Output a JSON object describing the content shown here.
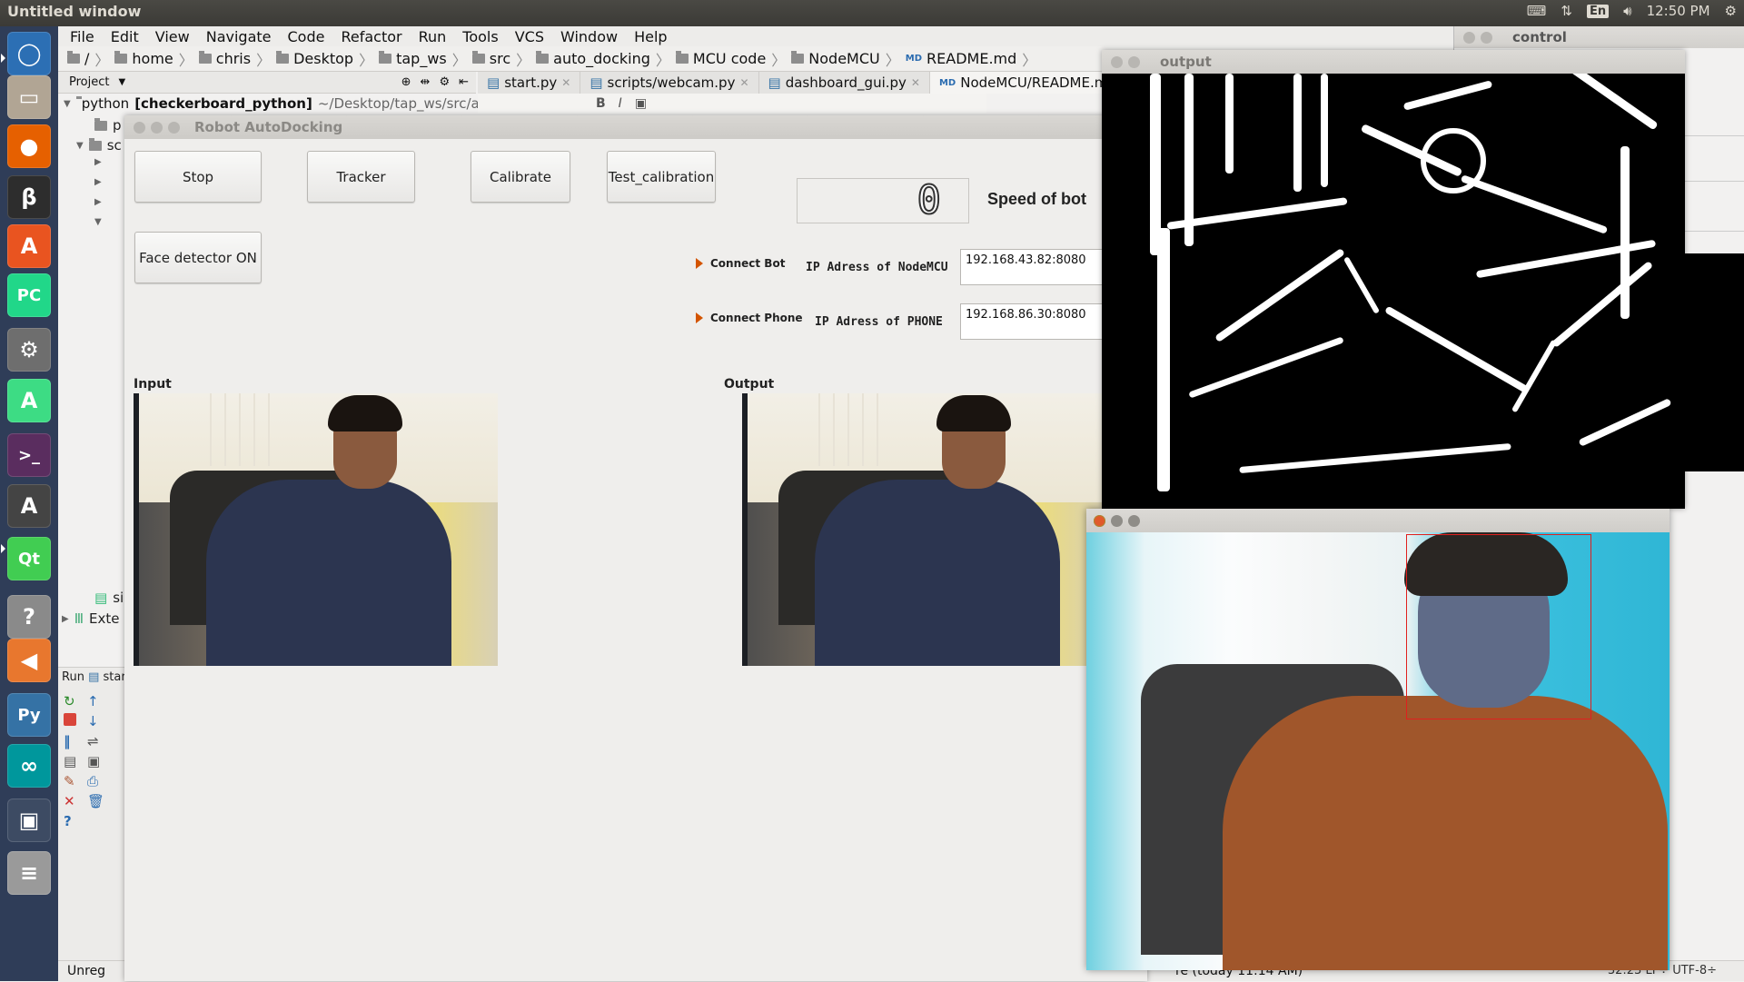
{
  "top_panel": {
    "title": "Untitled window",
    "kbd": "En",
    "time": "12:50 PM"
  },
  "launcher": {
    "items": [
      {
        "name": "dash-icon",
        "color": "#2c6fb4",
        "glyph": "◯"
      },
      {
        "name": "files-icon",
        "color": "#b1a594",
        "glyph": "▭"
      },
      {
        "name": "firefox-icon",
        "color": "#e66000",
        "glyph": "●"
      },
      {
        "name": "b3-icon",
        "color": "#2d2d2d",
        "glyph": "β"
      },
      {
        "name": "software-center-icon",
        "color": "#e95420",
        "glyph": "A"
      },
      {
        "name": "pycharm-icon",
        "color": "#21d789",
        "glyph": "PC"
      },
      {
        "name": "settings-icon",
        "color": "#6e6e6e",
        "glyph": "⚙"
      },
      {
        "name": "android-studio-icon",
        "color": "#3ddc84",
        "glyph": "A"
      },
      {
        "name": "terminal-icon",
        "color": "#5a2d5f",
        "glyph": ">_"
      },
      {
        "name": "updater-icon",
        "color": "#444",
        "glyph": "A"
      },
      {
        "name": "qt-creator-icon",
        "color": "#41cd52",
        "glyph": "Qt"
      },
      {
        "name": "help-icon",
        "color": "#8a8a8a",
        "glyph": "?"
      },
      {
        "name": "back-icon",
        "color": "#e8772e",
        "glyph": "◀"
      },
      {
        "name": "python-icon",
        "color": "#3572a5",
        "glyph": "Py"
      },
      {
        "name": "arduino-icon",
        "color": "#00979c",
        "glyph": "∞"
      },
      {
        "name": "workspace-icon",
        "color": "#3d4b63",
        "glyph": "▣"
      },
      {
        "name": "trash-icon",
        "color": "#9a9a9a",
        "glyph": "≡"
      }
    ]
  },
  "ide": {
    "menu": [
      "File",
      "Edit",
      "View",
      "Navigate",
      "Code",
      "Refactor",
      "Run",
      "Tools",
      "VCS",
      "Window",
      "Help"
    ],
    "breadcrumb": [
      "/",
      "home",
      "chris",
      "Desktop",
      "tap_ws",
      "src",
      "auto_docking",
      "MCU code",
      "NodeMCU",
      "README.md"
    ],
    "project_label": "Project",
    "tabs": [
      "start.py",
      "scripts/webcam.py",
      "dashboard_gui.py",
      "NodeMCU/README.md"
    ],
    "tree_root": "python",
    "tree_root_bold": "[checkerboard_python]",
    "tree_root_path": "~/Desktop/tap_ws/src/auto",
    "tree_stubs": [
      "p",
      "sc",
      "si",
      "Exte"
    ],
    "format_bold": "B",
    "format_italic": "I",
    "run_label": "Run",
    "run_target": "star",
    "status_left": "Unreg",
    "status_mid": "re (today 11:14 AM)",
    "status_right": "32:23  LF÷  UTF-8÷"
  },
  "control": {
    "title": "control"
  },
  "robot": {
    "title": "Robot AutoDocking",
    "buttons": {
      "stop": "Stop",
      "tracker": "Tracker",
      "calibrate": "Calibrate",
      "test_calibration": "Test_calibration",
      "face_detector": "Face detector ON"
    },
    "speed_value": "0",
    "speed_label": "Speed of bot",
    "connect_bot": "Connect Bot",
    "connect_phone": "Connect Phone",
    "ip_nodemcu_label": "IP Adress of NodeMCU",
    "ip_phone_label": "IP Adress of PHONE",
    "ip_nodemcu_value": "192.168.43.82:8080",
    "ip_phone_value": "192.168.86.30:8080",
    "input_label": "Input",
    "output_label": "Output"
  },
  "output_window": {
    "title": "output"
  }
}
